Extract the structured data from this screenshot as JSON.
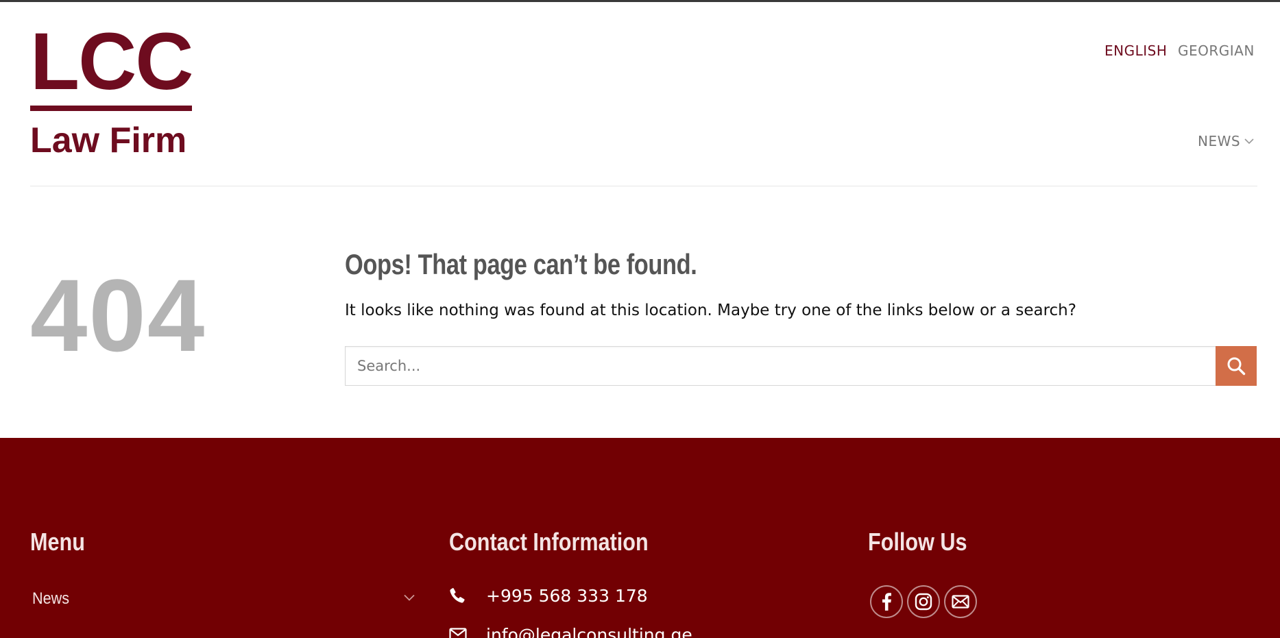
{
  "header": {
    "logo": {
      "main": "LCC",
      "sub": "Law Firm"
    },
    "languages": [
      {
        "label": "ENGLISH",
        "active": true
      },
      {
        "label": "GEORGIAN",
        "active": false
      }
    ],
    "nav": [
      {
        "label": "NEWS",
        "icon": "chevron-down-icon"
      }
    ]
  },
  "main": {
    "code": "404",
    "title": "Oops! That page can’t be found.",
    "message": "It looks like nothing was found at this location. Maybe try one of the links below or a search?",
    "search": {
      "placeholder": "Search...",
      "button_icon": "search-icon"
    }
  },
  "footer": {
    "menu": {
      "heading": "Menu",
      "items": [
        {
          "label": "News",
          "icon": "chevron-down-icon"
        }
      ]
    },
    "contact": {
      "heading": "Contact Information",
      "phone": "+995 568 333 178",
      "email": "info@legalconsulting.ge"
    },
    "follow": {
      "heading": "Follow Us",
      "icons": [
        "facebook-icon",
        "instagram-icon",
        "email-icon"
      ]
    }
  },
  "colors": {
    "brand": "#6e0c1f",
    "footer_bg": "#720003",
    "search_button": "#d26e48",
    "code_gray": "#b4b4b4"
  }
}
